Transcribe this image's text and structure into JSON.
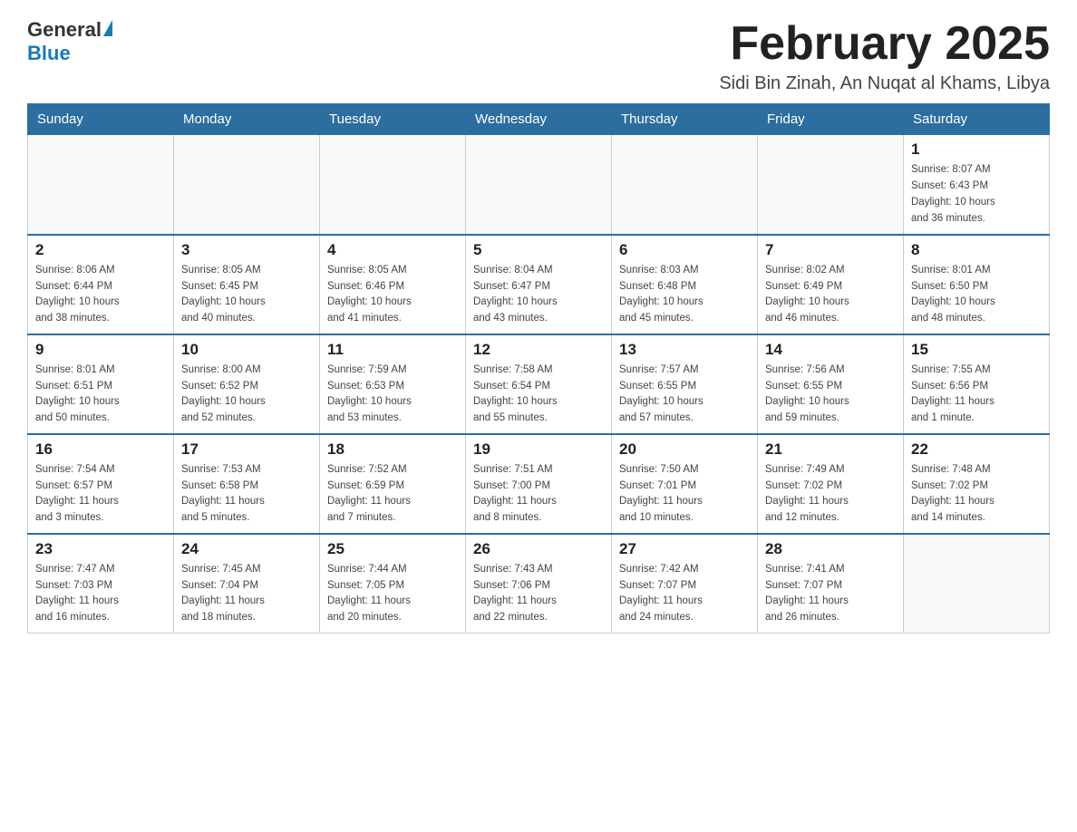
{
  "header": {
    "logo_general": "General",
    "logo_blue": "Blue",
    "month_title": "February 2025",
    "subtitle": "Sidi Bin Zinah, An Nuqat al Khams, Libya"
  },
  "weekdays": [
    "Sunday",
    "Monday",
    "Tuesday",
    "Wednesday",
    "Thursday",
    "Friday",
    "Saturday"
  ],
  "weeks": [
    [
      {
        "day": "",
        "info": ""
      },
      {
        "day": "",
        "info": ""
      },
      {
        "day": "",
        "info": ""
      },
      {
        "day": "",
        "info": ""
      },
      {
        "day": "",
        "info": ""
      },
      {
        "day": "",
        "info": ""
      },
      {
        "day": "1",
        "info": "Sunrise: 8:07 AM\nSunset: 6:43 PM\nDaylight: 10 hours\nand 36 minutes."
      }
    ],
    [
      {
        "day": "2",
        "info": "Sunrise: 8:06 AM\nSunset: 6:44 PM\nDaylight: 10 hours\nand 38 minutes."
      },
      {
        "day": "3",
        "info": "Sunrise: 8:05 AM\nSunset: 6:45 PM\nDaylight: 10 hours\nand 40 minutes."
      },
      {
        "day": "4",
        "info": "Sunrise: 8:05 AM\nSunset: 6:46 PM\nDaylight: 10 hours\nand 41 minutes."
      },
      {
        "day": "5",
        "info": "Sunrise: 8:04 AM\nSunset: 6:47 PM\nDaylight: 10 hours\nand 43 minutes."
      },
      {
        "day": "6",
        "info": "Sunrise: 8:03 AM\nSunset: 6:48 PM\nDaylight: 10 hours\nand 45 minutes."
      },
      {
        "day": "7",
        "info": "Sunrise: 8:02 AM\nSunset: 6:49 PM\nDaylight: 10 hours\nand 46 minutes."
      },
      {
        "day": "8",
        "info": "Sunrise: 8:01 AM\nSunset: 6:50 PM\nDaylight: 10 hours\nand 48 minutes."
      }
    ],
    [
      {
        "day": "9",
        "info": "Sunrise: 8:01 AM\nSunset: 6:51 PM\nDaylight: 10 hours\nand 50 minutes."
      },
      {
        "day": "10",
        "info": "Sunrise: 8:00 AM\nSunset: 6:52 PM\nDaylight: 10 hours\nand 52 minutes."
      },
      {
        "day": "11",
        "info": "Sunrise: 7:59 AM\nSunset: 6:53 PM\nDaylight: 10 hours\nand 53 minutes."
      },
      {
        "day": "12",
        "info": "Sunrise: 7:58 AM\nSunset: 6:54 PM\nDaylight: 10 hours\nand 55 minutes."
      },
      {
        "day": "13",
        "info": "Sunrise: 7:57 AM\nSunset: 6:55 PM\nDaylight: 10 hours\nand 57 minutes."
      },
      {
        "day": "14",
        "info": "Sunrise: 7:56 AM\nSunset: 6:55 PM\nDaylight: 10 hours\nand 59 minutes."
      },
      {
        "day": "15",
        "info": "Sunrise: 7:55 AM\nSunset: 6:56 PM\nDaylight: 11 hours\nand 1 minute."
      }
    ],
    [
      {
        "day": "16",
        "info": "Sunrise: 7:54 AM\nSunset: 6:57 PM\nDaylight: 11 hours\nand 3 minutes."
      },
      {
        "day": "17",
        "info": "Sunrise: 7:53 AM\nSunset: 6:58 PM\nDaylight: 11 hours\nand 5 minutes."
      },
      {
        "day": "18",
        "info": "Sunrise: 7:52 AM\nSunset: 6:59 PM\nDaylight: 11 hours\nand 7 minutes."
      },
      {
        "day": "19",
        "info": "Sunrise: 7:51 AM\nSunset: 7:00 PM\nDaylight: 11 hours\nand 8 minutes."
      },
      {
        "day": "20",
        "info": "Sunrise: 7:50 AM\nSunset: 7:01 PM\nDaylight: 11 hours\nand 10 minutes."
      },
      {
        "day": "21",
        "info": "Sunrise: 7:49 AM\nSunset: 7:02 PM\nDaylight: 11 hours\nand 12 minutes."
      },
      {
        "day": "22",
        "info": "Sunrise: 7:48 AM\nSunset: 7:02 PM\nDaylight: 11 hours\nand 14 minutes."
      }
    ],
    [
      {
        "day": "23",
        "info": "Sunrise: 7:47 AM\nSunset: 7:03 PM\nDaylight: 11 hours\nand 16 minutes."
      },
      {
        "day": "24",
        "info": "Sunrise: 7:45 AM\nSunset: 7:04 PM\nDaylight: 11 hours\nand 18 minutes."
      },
      {
        "day": "25",
        "info": "Sunrise: 7:44 AM\nSunset: 7:05 PM\nDaylight: 11 hours\nand 20 minutes."
      },
      {
        "day": "26",
        "info": "Sunrise: 7:43 AM\nSunset: 7:06 PM\nDaylight: 11 hours\nand 22 minutes."
      },
      {
        "day": "27",
        "info": "Sunrise: 7:42 AM\nSunset: 7:07 PM\nDaylight: 11 hours\nand 24 minutes."
      },
      {
        "day": "28",
        "info": "Sunrise: 7:41 AM\nSunset: 7:07 PM\nDaylight: 11 hours\nand 26 minutes."
      },
      {
        "day": "",
        "info": ""
      }
    ]
  ]
}
